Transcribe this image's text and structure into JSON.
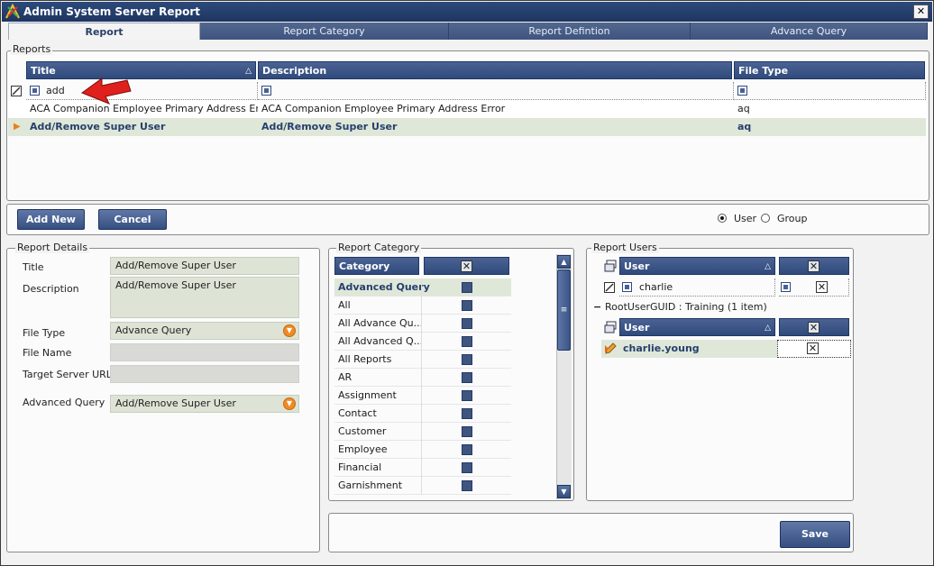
{
  "window": {
    "title": "Admin System Server Report",
    "close_glyph": "✕"
  },
  "tabs": [
    {
      "label": "Report",
      "active": true
    },
    {
      "label": "Report Category",
      "active": false
    },
    {
      "label": "Report Defintion",
      "active": false
    },
    {
      "label": "Advance Query",
      "active": false
    }
  ],
  "reports": {
    "legend": "Reports",
    "columns": [
      "Title",
      "Description",
      "File Type"
    ],
    "filter_text": "add",
    "rows": [
      {
        "title": "ACA Companion Employee Primary Address Error",
        "description": "ACA Companion Employee Primary Address Error",
        "file_type": "aq",
        "selected": false
      },
      {
        "title": "Add/Remove Super User",
        "description": "Add/Remove Super User",
        "file_type": "aq",
        "selected": true
      }
    ]
  },
  "toolbar": {
    "add_label": "Add New",
    "cancel_label": "Cancel",
    "user_label": "User",
    "group_label": "Group",
    "selected_option": "User"
  },
  "details": {
    "legend": "Report Details",
    "title_label": "Title",
    "title_value": "Add/Remove Super User",
    "description_label": "Description",
    "description_value": "Add/Remove Super User",
    "file_type_label": "File Type",
    "file_type_value": "Advance Query",
    "file_name_label": "File Name",
    "file_name_value": "",
    "target_label": "Target Server URL",
    "target_value": "",
    "advanced_query_label": "Advanced Query",
    "advanced_query_value": "Add/Remove Super User"
  },
  "category": {
    "legend": "Report Category",
    "column": "Category",
    "items": [
      "Advanced Query",
      "All",
      "All Advance Qu...",
      "All Advanced Q...",
      "All Reports",
      "AR",
      "Assignment",
      "Contact",
      "Customer",
      "Employee",
      "Financial",
      "Garnishment"
    ]
  },
  "users": {
    "legend": "Report Users",
    "column": "User",
    "filter_value": "charlie",
    "group_label": "RootUserGUID : Training (1 item)",
    "group_toggle": "−",
    "rows": [
      {
        "user": "charlie.young"
      }
    ]
  },
  "footer": {
    "save_label": "Save"
  },
  "colors": {
    "accent": "#2f4a7c",
    "selected_row": "#dfe7d9",
    "dropdown": "#f08a24",
    "arrow": "#e0201c"
  }
}
